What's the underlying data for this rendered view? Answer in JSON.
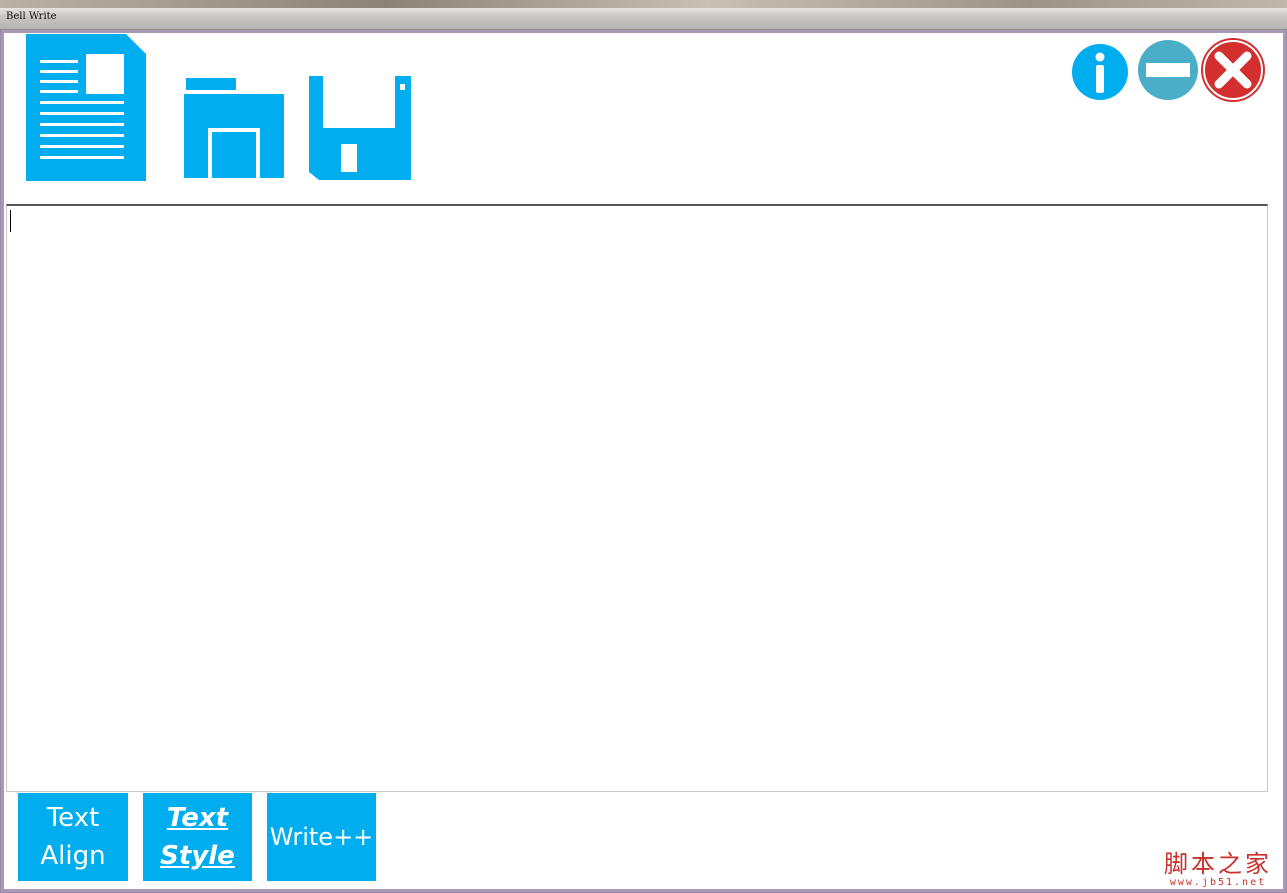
{
  "window": {
    "title": "Bell Write"
  },
  "toolbar": {
    "new_icon": "document-icon",
    "open_icon": "folder-icon",
    "save_icon": "floppy-disk-icon"
  },
  "window_controls": {
    "info_icon": "info-icon",
    "minimize_icon": "minimize-icon",
    "close_icon": "close-icon"
  },
  "editor": {
    "content": ""
  },
  "bottom_buttons": {
    "text_align_line1": "Text",
    "text_align_line2": "Align",
    "text_style_line1": "Text",
    "text_style_line2": "Style",
    "write_plus": "Write++"
  },
  "watermark": {
    "main": "脚本之家",
    "sub": "www.jb51.net"
  },
  "colors": {
    "accent": "#00aeef",
    "info": "#00aeef",
    "minimize": "#4aaec8",
    "close": "#d32f2f",
    "watermark": "#c9302c"
  }
}
